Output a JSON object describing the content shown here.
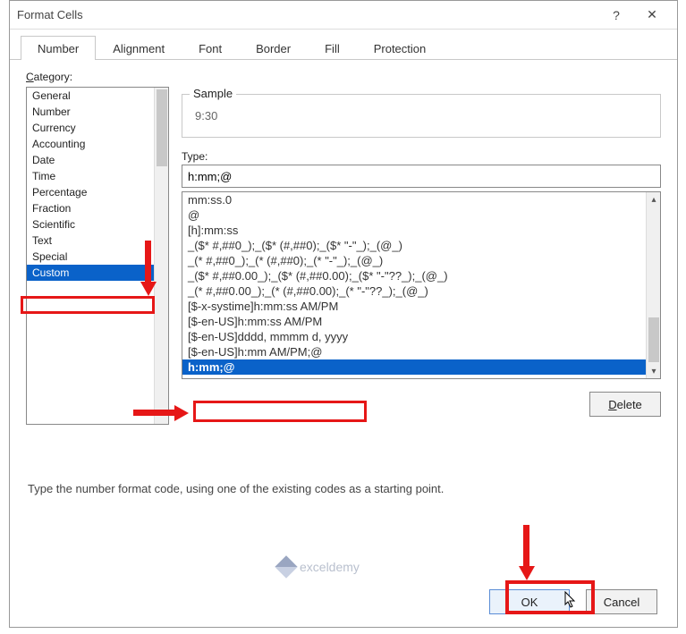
{
  "titlebar": {
    "title": "Format Cells",
    "help": "?",
    "close": "✕"
  },
  "tabs": [
    {
      "label": "Number",
      "active": true
    },
    {
      "label": "Alignment"
    },
    {
      "label": "Font"
    },
    {
      "label": "Border"
    },
    {
      "label": "Fill"
    },
    {
      "label": "Protection"
    }
  ],
  "left": {
    "category_label_prefix": "C",
    "category_label_rest": "ategory:",
    "categories": [
      "General",
      "Number",
      "Currency",
      "Accounting",
      "Date",
      "Time",
      "Percentage",
      "Fraction",
      "Scientific",
      "Text",
      "Special",
      "Custom"
    ],
    "selected_index": 11
  },
  "right": {
    "sample_label": "Sample",
    "sample_value": "9:30",
    "type_label_prefix": "T",
    "type_label_rest": "ype:",
    "type_value": "h:mm;@",
    "format_list": [
      "mm:ss.0",
      "@",
      "[h]:mm:ss",
      "_($* #,##0_);_($* (#,##0);_($* \"-\"_);_(@_)",
      "_(* #,##0_);_(* (#,##0);_(* \"-\"_);_(@_)",
      "_($* #,##0.00_);_($* (#,##0.00);_($* \"-\"??_);_(@_)",
      "_(* #,##0.00_);_(* (#,##0.00);_(* \"-\"??_);_(@_)",
      "[$-x-systime]h:mm:ss AM/PM",
      "[$-en-US]h:mm:ss AM/PM",
      "[$-en-US]dddd, mmmm d, yyyy",
      "[$-en-US]h:mm AM/PM;@",
      "h:mm;@"
    ],
    "selected_format_index": 11,
    "delete_prefix": "D",
    "delete_rest": "elete"
  },
  "hint": "Type the number format code, using one of the existing codes as a starting point.",
  "footer": {
    "ok": "OK",
    "cancel": "Cancel"
  },
  "watermark": "exceldemy"
}
